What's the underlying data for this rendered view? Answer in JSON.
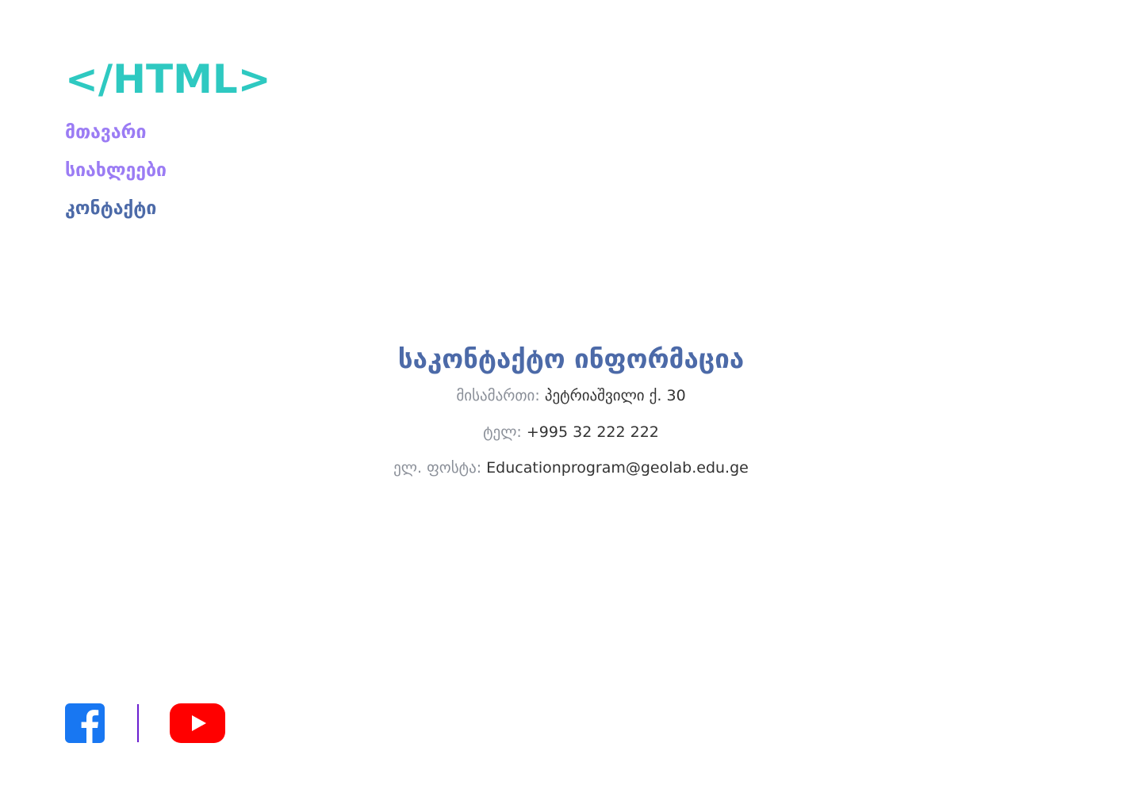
{
  "logo": {
    "text": "</HTML>",
    "color": "#2ec9c1"
  },
  "nav": {
    "items": [
      {
        "label": "მთავარი",
        "active": false
      },
      {
        "label": "სიახლეები",
        "active": false
      },
      {
        "label": "კონტაქტი",
        "active": true
      }
    ],
    "link_color": "#9b7cf4",
    "active_color": "#4c6aa8"
  },
  "contact": {
    "title": "საკონტაქტო ინფორმაცია",
    "address_label": "მისამართი:",
    "address_value": "პეტრიაშვილი ქ. 30",
    "phone_label": "ტელ:",
    "phone_value": "+995 32 222 222",
    "email_label": "ელ. ფოსტა:",
    "email_value": "Educationprogram@geolab.edu.ge"
  },
  "social": {
    "icons": [
      "facebook-icon",
      "youtube-icon"
    ],
    "facebook_color": "#1877f2",
    "youtube_color": "#ff0000",
    "divider_color": "#6a1fd0"
  }
}
